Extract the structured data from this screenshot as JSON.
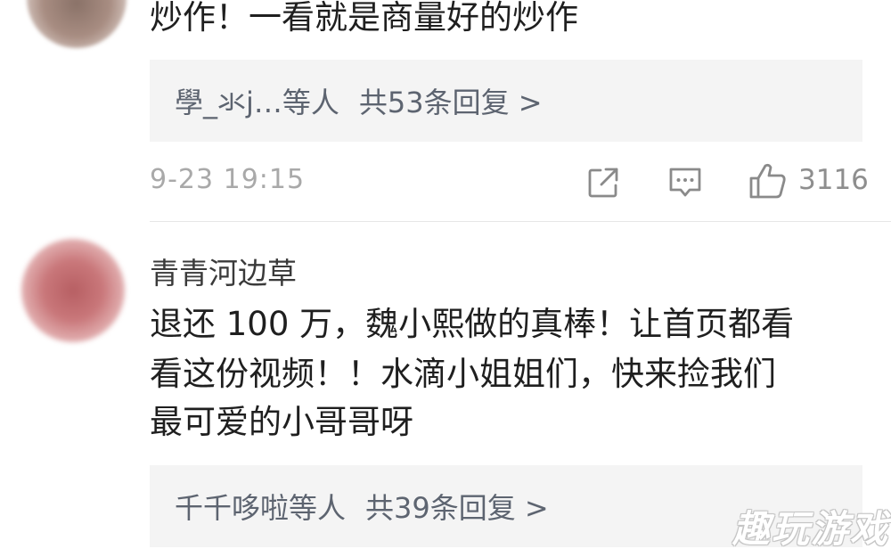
{
  "comment_top": {
    "text": "炒作！一看就是商量好的炒作",
    "reply_summary": {
      "users": "學_氺j…等人",
      "count_label": "共53条回复 >"
    },
    "timestamp": "9-23 19:15",
    "like_count": "3116"
  },
  "comment_second": {
    "username": "青青河边草",
    "body_lines": [
      "退还 100 万，魏小熙做的真棒！让首页都看",
      "看这份视频！！水滴小姐姐们，快来捡我们",
      "最可爱的小哥哥呀"
    ],
    "reply_summary": {
      "users": "千千哆啦等人",
      "count_label": "共39条回复 >"
    }
  },
  "watermark": "趣玩游戏",
  "icons": {
    "share": "share-icon",
    "comment": "comment-icon",
    "like": "thumbs-up-icon"
  },
  "colors": {
    "reply_box_bg": "#f4f4f4",
    "reply_text": "#5d6470",
    "meta_gray": "#a9a9a9"
  }
}
